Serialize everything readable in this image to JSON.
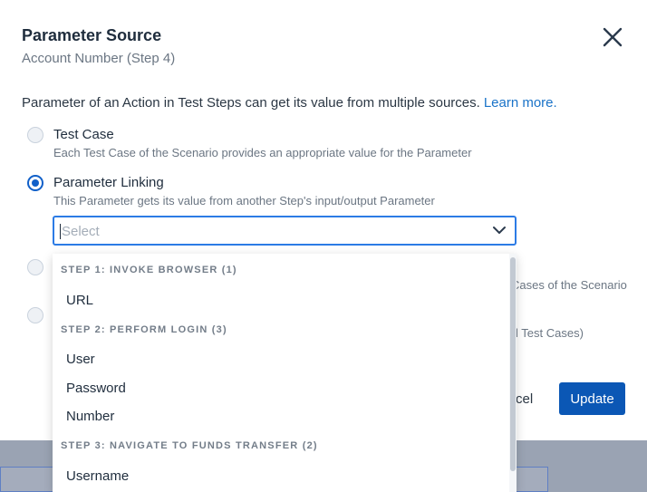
{
  "dialog": {
    "title": "Parameter Source",
    "subtitle": "Account Number (Step 4)",
    "intro": "Parameter of an Action in Test Steps can get its value from multiple sources.",
    "learn_more": "Learn more."
  },
  "options": [
    {
      "label": "Test Case",
      "description": "Each Test Case of the Scenario provides an appropriate value for the Parameter",
      "selected": false
    },
    {
      "label": "Parameter Linking",
      "description": "This Parameter gets its value from another Step's input/output Parameter",
      "selected": true
    }
  ],
  "select": {
    "placeholder": "Select"
  },
  "occluded": {
    "option3_desc_tail": "Cases of the Scenario",
    "option4_desc_tail": "l Test Cases)"
  },
  "dropdown": {
    "groups": [
      {
        "header": "STEP 1: INVOKE BROWSER (1)",
        "items": [
          "URL"
        ]
      },
      {
        "header": "STEP 2: PERFORM LOGIN (3)",
        "items": [
          "User",
          "Password",
          "Number"
        ]
      },
      {
        "header": "STEP 3: NAVIGATE TO FUNDS TRANSFER (2)",
        "items": [
          "Username"
        ]
      }
    ]
  },
  "footer": {
    "cancel_partial": "cel",
    "update": "Update"
  },
  "colors": {
    "accent": "#0b57b5",
    "focus": "#2c7be5",
    "link": "#1a73c8"
  },
  "icons": {
    "close": "close-icon",
    "chevron": "chevron-down-icon"
  }
}
